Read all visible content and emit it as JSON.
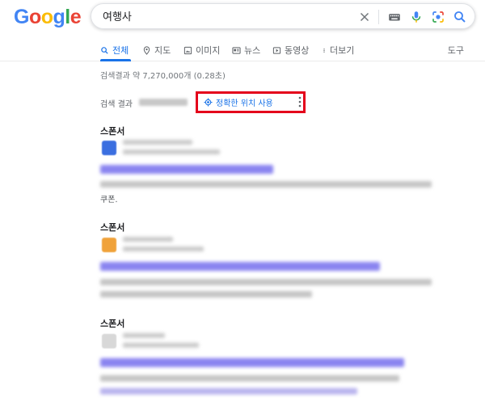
{
  "logo": {
    "letters": [
      "G",
      "o",
      "o",
      "g",
      "l",
      "e"
    ],
    "colors": [
      "#4285f4",
      "#ea4335",
      "#fbbc05",
      "#4285f4",
      "#34a853",
      "#ea4335"
    ]
  },
  "search": {
    "query": "여행사"
  },
  "icons": {
    "clear": "close-icon",
    "keyboard": "keyboard-icon",
    "voice": "microphone-icon",
    "lens": "camera-lens-icon",
    "search": "search-icon"
  },
  "tabs": [
    {
      "label": "전체",
      "icon": "search-icon",
      "active": true
    },
    {
      "label": "지도",
      "icon": "map-pin-icon"
    },
    {
      "label": "이미지",
      "icon": "image-icon"
    },
    {
      "label": "뉴스",
      "icon": "news-icon"
    },
    {
      "label": "동영상",
      "icon": "play-icon"
    },
    {
      "label": "더보기",
      "icon": "more-vert-icon"
    }
  ],
  "tools_label": "도구",
  "stats": "검색결과 약 7,270,000개 (0.28초)",
  "location": {
    "label": "검색 결과",
    "precise_label": "정확한 위치 사용"
  },
  "ads": [
    {
      "sponsor_label": "스폰서",
      "tail_text": "쿠폰."
    },
    {
      "sponsor_label": "스폰서"
    },
    {
      "sponsor_label": "스폰서"
    }
  ],
  "colors": {
    "accent": "#1a73e8",
    "highlight": "#e4001b",
    "muted": "#5f6368"
  }
}
